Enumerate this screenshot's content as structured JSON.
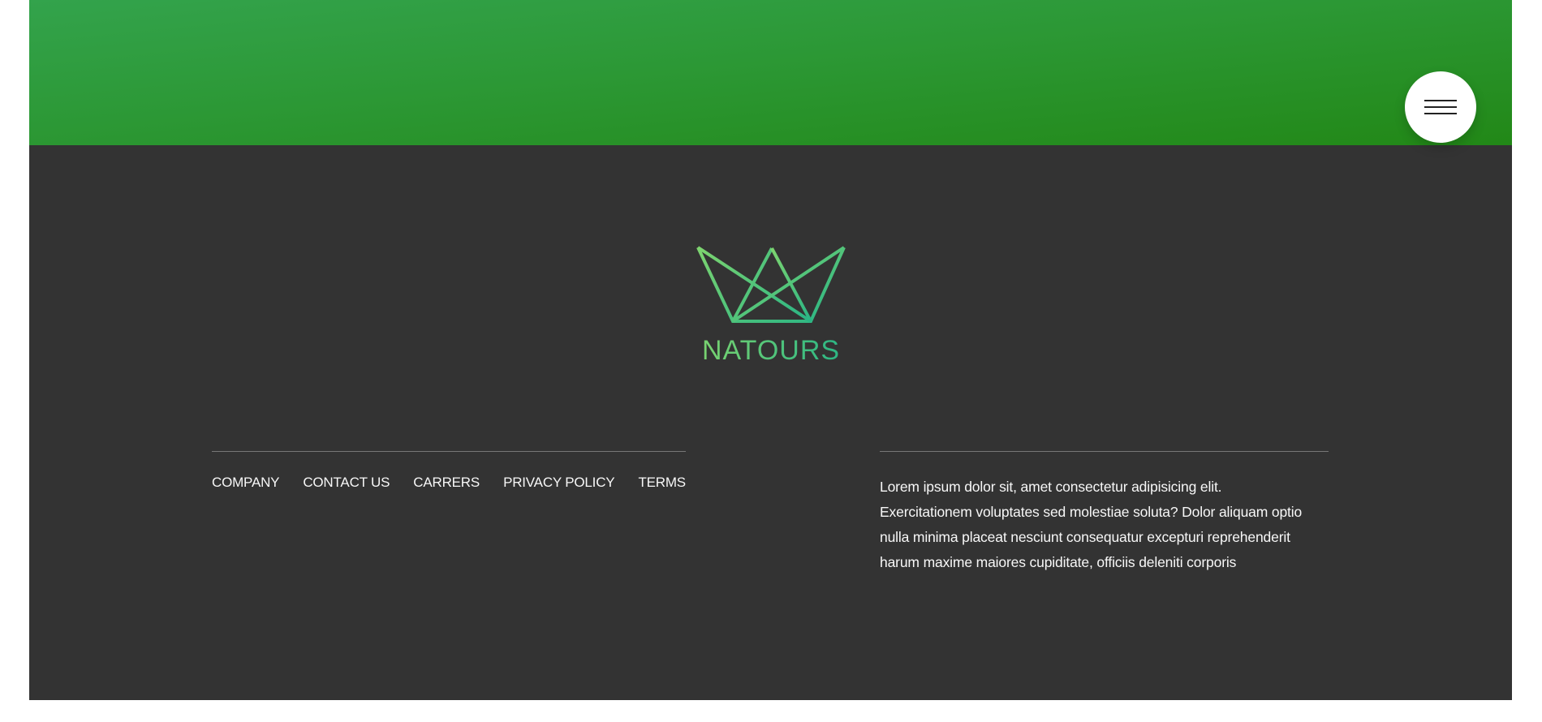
{
  "brand": {
    "name": "NATOURS",
    "logo_icon": "crown-icon",
    "colors": {
      "hero_gradient_start": "#33a34c",
      "hero_gradient_end": "#228817",
      "logo_gradient_start": "#7ed56f",
      "logo_gradient_end": "#28b485",
      "footer_background": "#333333"
    }
  },
  "menu_button": {
    "icon": "hamburger-icon"
  },
  "footer": {
    "nav_items": [
      {
        "label": "Company"
      },
      {
        "label": "Contact us"
      },
      {
        "label": "Carrers"
      },
      {
        "label": "Privacy policy"
      },
      {
        "label": "Terms"
      }
    ],
    "copy": "Lorem ipsum dolor sit, amet consectetur adipisicing elit. Exercitationem voluptates sed molestiae soluta? Dolor aliquam optio nulla minima placeat nesciunt consequatur excepturi reprehenderit harum maxime maiores cupiditate, officiis deleniti corporis"
  }
}
